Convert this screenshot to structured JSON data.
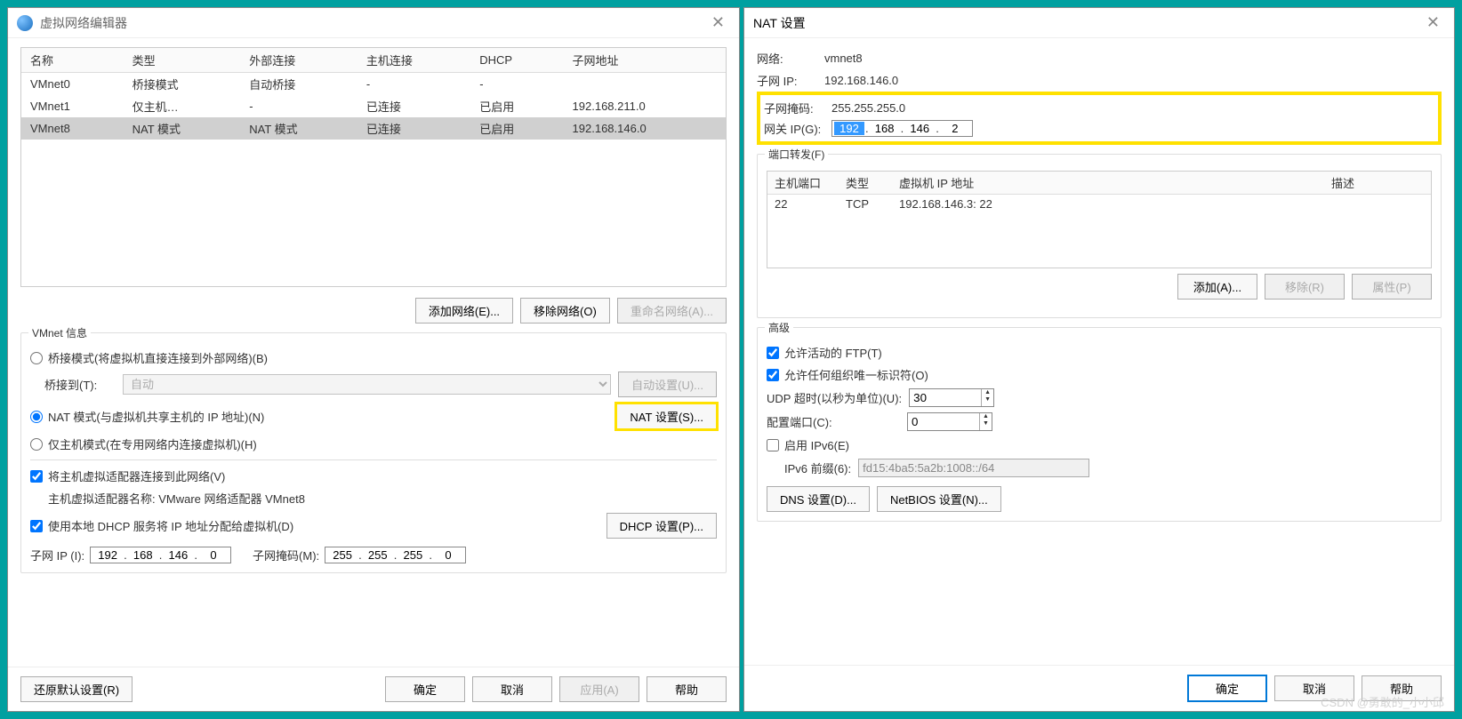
{
  "leftWindow": {
    "title": "虚拟网络编辑器",
    "columns": {
      "name": "名称",
      "type": "类型",
      "external": "外部连接",
      "host": "主机连接",
      "dhcp": "DHCP",
      "subnet": "子网地址"
    },
    "rows": [
      {
        "name": "VMnet0",
        "type": "桥接模式",
        "external": "自动桥接",
        "host": "-",
        "dhcp": "-",
        "subnet": ""
      },
      {
        "name": "VMnet1",
        "type": "仅主机…",
        "external": "-",
        "host": "已连接",
        "dhcp": "已启用",
        "subnet": "192.168.211.0"
      },
      {
        "name": "VMnet8",
        "type": "NAT 模式",
        "external": "NAT 模式",
        "host": "已连接",
        "dhcp": "已启用",
        "subnet": "192.168.146.0"
      }
    ],
    "buttons": {
      "add": "添加网络(E)...",
      "remove": "移除网络(O)",
      "rename": "重命名网络(A)..."
    },
    "vmnetInfo": {
      "legend": "VMnet 信息",
      "bridgeRadio": "桥接模式(将虚拟机直接连接到外部网络)(B)",
      "bridgeToLabel": "桥接到(T):",
      "bridgeToValue": "自动",
      "autoSettings": "自动设置(U)...",
      "natRadio": "NAT 模式(与虚拟机共享主机的 IP 地址)(N)",
      "natSettings": "NAT 设置(S)...",
      "hostOnlyRadio": "仅主机模式(在专用网络内连接虚拟机)(H)",
      "connectHost": "将主机虚拟适配器连接到此网络(V)",
      "adapterName": "主机虚拟适配器名称: VMware 网络适配器 VMnet8",
      "useDhcp": "使用本地 DHCP 服务将 IP 地址分配给虚拟机(D)",
      "dhcpSettings": "DHCP 设置(P)...",
      "subnetIpLabel": "子网 IP (I):",
      "subnetIp": [
        "192",
        "168",
        "146",
        "0"
      ],
      "subnetMaskLabel": "子网掩码(M):",
      "subnetMask": [
        "255",
        "255",
        "255",
        "0"
      ]
    },
    "bottom": {
      "restore": "还原默认设置(R)",
      "ok": "确定",
      "cancel": "取消",
      "apply": "应用(A)",
      "help": "帮助"
    }
  },
  "rightWindow": {
    "title": "NAT 设置",
    "networkLabel": "网络:",
    "networkValue": "vmnet8",
    "subnetIpLabel": "子网 IP:",
    "subnetIpValue": "192.168.146.0",
    "subnetMaskLabel": "子网掩码:",
    "subnetMaskValue": "255.255.255.0",
    "gatewayLabel": "网关 IP(G):",
    "gatewayIp": [
      "192",
      "168",
      "146",
      "2"
    ],
    "portForward": {
      "legend": "端口转发(F)",
      "columns": {
        "hostPort": "主机端口",
        "type": "类型",
        "vmIp": "虚拟机 IP 地址",
        "desc": "描述"
      },
      "rows": [
        {
          "hostPort": "22",
          "type": "TCP",
          "vmIp": "192.168.146.3: 22",
          "desc": ""
        }
      ],
      "add": "添加(A)...",
      "remove": "移除(R)",
      "prop": "属性(P)"
    },
    "advanced": {
      "legend": "高级",
      "allowFtp": "允许活动的 FTP(T)",
      "allowOrg": "允许任何组织唯一标识符(O)",
      "udpTimeoutLabel": "UDP 超时(以秒为单位)(U):",
      "udpTimeout": "30",
      "configPortLabel": "配置端口(C):",
      "configPort": "0",
      "enableIpv6": "启用 IPv6(E)",
      "ipv6PrefixLabel": "IPv6 前缀(6):",
      "ipv6Prefix": "fd15:4ba5:5a2b:1008::/64",
      "dnsSettings": "DNS 设置(D)...",
      "netbiosSettings": "NetBIOS 设置(N)..."
    },
    "bottom": {
      "ok": "确定",
      "cancel": "取消",
      "help": "帮助"
    }
  },
  "watermark": "CSDN @勇敢的_小小邱"
}
